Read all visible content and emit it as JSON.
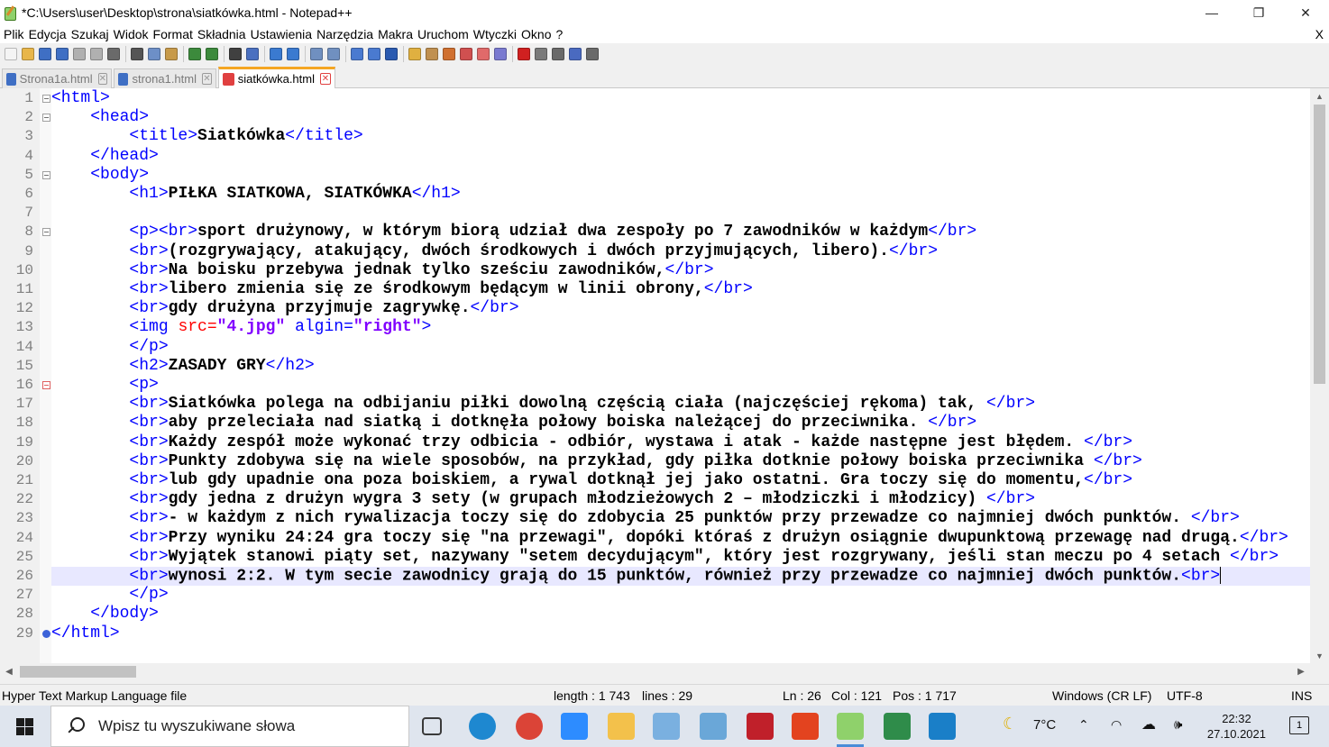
{
  "window": {
    "title": "*C:\\Users\\user\\Desktop\\strona\\siatkówka.html - Notepad++",
    "minimize": "—",
    "maximize": "❐",
    "close": "✕"
  },
  "menu": {
    "items": [
      "Plik",
      "Edycja",
      "Szukaj",
      "Widok",
      "Format",
      "Składnia",
      "Ustawienia",
      "Narzędzia",
      "Makra",
      "Uruchom",
      "Wtyczki",
      "Okno",
      "?"
    ],
    "close_doc": "X"
  },
  "toolbar": {
    "buttons": [
      {
        "name": "new-file-icon",
        "color": "#f4f4f4"
      },
      {
        "name": "open-file-icon",
        "color": "#e8b64a"
      },
      {
        "name": "save-icon",
        "color": "#3f6fc4"
      },
      {
        "name": "save-all-icon",
        "color": "#3f6fc4"
      },
      {
        "name": "close-icon",
        "color": "#b0b0b0"
      },
      {
        "name": "close-all-icon",
        "color": "#b0b0b0"
      },
      {
        "name": "print-icon",
        "color": "#6a6a6a"
      },
      {
        "sep": true
      },
      {
        "name": "cut-icon",
        "color": "#555555"
      },
      {
        "name": "copy-icon",
        "color": "#6d8fc7"
      },
      {
        "name": "paste-icon",
        "color": "#c79a4a"
      },
      {
        "sep": true
      },
      {
        "name": "undo-icon",
        "color": "#3c8a3c"
      },
      {
        "name": "redo-icon",
        "color": "#3c8a3c"
      },
      {
        "sep": true
      },
      {
        "name": "find-icon",
        "color": "#404040"
      },
      {
        "name": "replace-icon",
        "color": "#4a70c0"
      },
      {
        "sep": true
      },
      {
        "name": "zoom-in-icon",
        "color": "#3a7ad0"
      },
      {
        "name": "zoom-out-icon",
        "color": "#3a7ad0"
      },
      {
        "sep": true
      },
      {
        "name": "sync-vertical-icon",
        "color": "#7090c0"
      },
      {
        "name": "sync-horizontal-icon",
        "color": "#7090c0"
      },
      {
        "sep": true
      },
      {
        "name": "word-wrap-icon",
        "color": "#4a7ad0"
      },
      {
        "name": "show-all-chars-icon",
        "color": "#4a7ad0"
      },
      {
        "name": "indent-guide-icon",
        "color": "#2a5ab0"
      },
      {
        "sep": true
      },
      {
        "name": "udl-icon",
        "color": "#e0b040"
      },
      {
        "name": "doc-map-icon",
        "color": "#c09050"
      },
      {
        "name": "function-list-icon",
        "color": "#d07030"
      },
      {
        "name": "folder-workspace-icon",
        "color": "#d05050"
      },
      {
        "name": "doc-list-icon",
        "color": "#e06a6a"
      },
      {
        "name": "monitoring-icon",
        "color": "#7a7ad0"
      },
      {
        "sep": true
      },
      {
        "name": "record-macro-icon",
        "color": "#d02020"
      },
      {
        "name": "stop-macro-icon",
        "color": "#7a7a7a"
      },
      {
        "name": "play-macro-icon",
        "color": "#6a6a6a"
      },
      {
        "name": "run-macro-multiple-icon",
        "color": "#4a6ac0"
      },
      {
        "name": "save-macro-icon",
        "color": "#6a6a6a"
      }
    ]
  },
  "tabs": [
    {
      "label": "Strona1a.html",
      "active": false,
      "disk": "#3f6fc4"
    },
    {
      "label": "strona1.html",
      "active": false,
      "disk": "#3f6fc4"
    },
    {
      "label": "siatkówka.html",
      "active": true,
      "disk": "#e04040"
    }
  ],
  "editor": {
    "current_line": 26,
    "fold_open": [
      1,
      2,
      5,
      8,
      16
    ],
    "fold_end": [
      29
    ],
    "lines": [
      [
        [
          "tag",
          "<html>"
        ]
      ],
      [
        [
          "txt",
          "    "
        ],
        [
          "tag",
          "<head>"
        ]
      ],
      [
        [
          "txt",
          "        "
        ],
        [
          "tag",
          "<title>"
        ],
        [
          "txt",
          "Siatkówka"
        ],
        [
          "tag",
          "</title>"
        ]
      ],
      [
        [
          "txt",
          "    "
        ],
        [
          "tag",
          "</head>"
        ]
      ],
      [
        [
          "txt",
          "    "
        ],
        [
          "tag",
          "<body>"
        ]
      ],
      [
        [
          "txt",
          "        "
        ],
        [
          "tag",
          "<h1>"
        ],
        [
          "txt",
          "PIŁKA SIATKOWA, SIATKÓWKA"
        ],
        [
          "tag",
          "</h1>"
        ]
      ],
      [],
      [
        [
          "txt",
          "        "
        ],
        [
          "tag",
          "<p><br>"
        ],
        [
          "txt",
          "sport drużynowy, w którym biorą udział dwa zespoły po 7 zawodników w każdym"
        ],
        [
          "tag",
          "</br>"
        ]
      ],
      [
        [
          "txt",
          "        "
        ],
        [
          "tag",
          "<br>"
        ],
        [
          "txt",
          "(rozgrywający, atakujący, dwóch środkowych i dwóch przyjmujących, libero)."
        ],
        [
          "tag",
          "</br>"
        ]
      ],
      [
        [
          "txt",
          "        "
        ],
        [
          "tag",
          "<br>"
        ],
        [
          "txt",
          "Na boisku przebywa jednak tylko sześciu zawodników,"
        ],
        [
          "tag",
          "</br>"
        ]
      ],
      [
        [
          "txt",
          "        "
        ],
        [
          "tag",
          "<br>"
        ],
        [
          "txt",
          "libero zmienia się ze środkowym będącym w linii obrony,"
        ],
        [
          "tag",
          "</br>"
        ]
      ],
      [
        [
          "txt",
          "        "
        ],
        [
          "tag",
          "<br>"
        ],
        [
          "txt",
          "gdy drużyna przyjmuje zagrywkę."
        ],
        [
          "tag",
          "</br>"
        ]
      ],
      [
        [
          "txt",
          "        "
        ],
        [
          "tag",
          "<img "
        ],
        [
          "attr",
          "src="
        ],
        [
          "val",
          "\"4.jpg\""
        ],
        [
          "tag",
          " algin="
        ],
        [
          "val",
          "\"right\""
        ],
        [
          "tag",
          ">"
        ]
      ],
      [
        [
          "txt",
          "        "
        ],
        [
          "tag",
          "</p>"
        ]
      ],
      [
        [
          "txt",
          "        "
        ],
        [
          "tag",
          "<h2>"
        ],
        [
          "txt",
          "ZASADY GRY"
        ],
        [
          "tag",
          "</h2>"
        ]
      ],
      [
        [
          "txt",
          "        "
        ],
        [
          "tag",
          "<p>"
        ]
      ],
      [
        [
          "txt",
          "        "
        ],
        [
          "tag",
          "<br>"
        ],
        [
          "txt",
          "Siatkówka polega na odbijaniu piłki dowolną częścią ciała (najczęściej rękoma) tak, "
        ],
        [
          "tag",
          "</br>"
        ]
      ],
      [
        [
          "txt",
          "        "
        ],
        [
          "tag",
          "<br>"
        ],
        [
          "txt",
          "aby przeleciała nad siatką i dotknęła połowy boiska należącej do przeciwnika. "
        ],
        [
          "tag",
          "</br>"
        ]
      ],
      [
        [
          "txt",
          "        "
        ],
        [
          "tag",
          "<br>"
        ],
        [
          "txt",
          "Każdy zespół może wykonać trzy odbicia - odbiór, wystawa i atak - każde następne jest błędem. "
        ],
        [
          "tag",
          "</br>"
        ]
      ],
      [
        [
          "txt",
          "        "
        ],
        [
          "tag",
          "<br>"
        ],
        [
          "txt",
          "Punkty zdobywa się na wiele sposobów, na przykład, gdy piłka dotknie połowy boiska przeciwnika "
        ],
        [
          "tag",
          "</br>"
        ]
      ],
      [
        [
          "txt",
          "        "
        ],
        [
          "tag",
          "<br>"
        ],
        [
          "txt",
          "lub gdy upadnie ona poza boiskiem, a rywal dotknął jej jako ostatni. Gra toczy się do momentu,"
        ],
        [
          "tag",
          "</br>"
        ]
      ],
      [
        [
          "txt",
          "        "
        ],
        [
          "tag",
          "<br>"
        ],
        [
          "txt",
          "gdy jedna z drużyn wygra 3 sety (w grupach młodzieżowych 2 – młodziczki i młodzicy) "
        ],
        [
          "tag",
          "</br>"
        ]
      ],
      [
        [
          "txt",
          "        "
        ],
        [
          "tag",
          "<br>"
        ],
        [
          "txt",
          "- w każdym z nich rywalizacja toczy się do zdobycia 25 punktów przy przewadze co najmniej dwóch punktów. "
        ],
        [
          "tag",
          "</br>"
        ]
      ],
      [
        [
          "txt",
          "        "
        ],
        [
          "tag",
          "<br>"
        ],
        [
          "txt",
          "Przy wyniku 24:24 gra toczy się \"na przewagi\", dopóki któraś z drużyn osiągnie dwupunktową przewagę nad drugą."
        ],
        [
          "tag",
          "</br>"
        ]
      ],
      [
        [
          "txt",
          "        "
        ],
        [
          "tag",
          "<br>"
        ],
        [
          "txt",
          "Wyjątek stanowi piąty set, nazywany \"setem decydującym\", który jest rozgrywany, jeśli stan meczu po 4 setach "
        ],
        [
          "tag",
          "</br>"
        ]
      ],
      [
        [
          "txt",
          "        "
        ],
        [
          "tag",
          "<br>"
        ],
        [
          "txt",
          "wynosi 2:2. W tym secie zawodnicy grają do 15 punktów, również przy przewadze co najmniej dwóch punktów."
        ],
        [
          "tag",
          "<br>"
        ]
      ],
      [
        [
          "txt",
          "        "
        ],
        [
          "tag",
          "</p>"
        ]
      ],
      [
        [
          "txt",
          "    "
        ],
        [
          "tag",
          "</body>"
        ]
      ],
      [
        [
          "tag",
          "</html>"
        ]
      ]
    ]
  },
  "status": {
    "file_type": "Hyper Text Markup Language file",
    "length": "length : 1 743",
    "lines": "lines : 29",
    "ln": "Ln : 26",
    "col": "Col : 121",
    "pos": "Pos : 1 717",
    "eol": "Windows (CR LF)",
    "encoding": "UTF-8",
    "mode": "INS"
  },
  "taskbar": {
    "search_placeholder": "Wpisz tu wyszukiwane słowa",
    "apps": [
      {
        "name": "task-view-icon",
        "color": "#3a3a3a",
        "active": false
      },
      {
        "name": "edge-icon",
        "color": "#1e88d0",
        "active": false
      },
      {
        "name": "chrome-icon",
        "color": "#db4437",
        "active": false
      },
      {
        "name": "zoom-icon",
        "color": "#2d8cff",
        "active": false
      },
      {
        "name": "file-explorer-icon",
        "color": "#f3c14b",
        "active": false
      },
      {
        "name": "paint-icon",
        "color": "#7ab0e0",
        "active": false
      },
      {
        "name": "notepad-icon",
        "color": "#6aa7d8",
        "active": false
      },
      {
        "name": "camera-app-icon",
        "color": "#c0202a",
        "active": false
      },
      {
        "name": "office-icon",
        "color": "#e3431f",
        "active": false
      },
      {
        "name": "notepad-plus-plus-icon",
        "color": "#8fd16b",
        "active": true
      },
      {
        "name": "sticky-app-icon",
        "color": "#2f8c4a",
        "active": false
      },
      {
        "name": "facebook-app-icon",
        "color": "#1a7fc8",
        "active": false
      }
    ],
    "weather": "7°C",
    "time": "22:32",
    "date": "27.10.2021",
    "notifications": "1"
  }
}
